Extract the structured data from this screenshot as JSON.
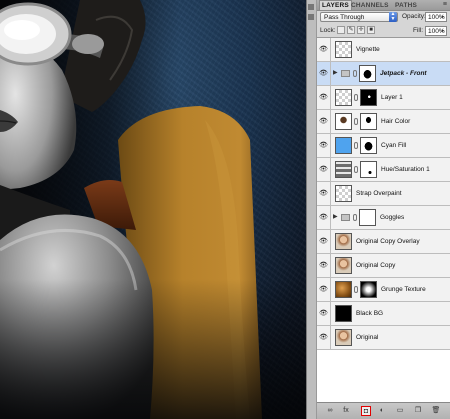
{
  "panel": {
    "tabs": [
      "LAYERS",
      "CHANNELS",
      "PATHS"
    ],
    "active_tab": "LAYERS",
    "menu_icon": "panel-menu-icon",
    "blend_mode": "Pass Through",
    "opacity_label": "Opacity:",
    "opacity_value": "100%",
    "lock_label": "Lock:",
    "fill_label": "Fill:",
    "fill_value": "100%",
    "layers": [
      {
        "name": "Vignette",
        "type": "pixel",
        "thumb": "checker",
        "mask": false,
        "group": false,
        "selected": false
      },
      {
        "name": "Jetpack - Front",
        "type": "group",
        "thumb": "folder",
        "mask": "figure",
        "group": true,
        "selected": true
      },
      {
        "name": "Layer 1",
        "type": "pixel",
        "thumb": "checker",
        "mask": "spot",
        "group": false,
        "selected": false
      },
      {
        "name": "Hair Color",
        "type": "adjustment",
        "thumb": "hair",
        "mask": "hair",
        "group": false,
        "selected": false
      },
      {
        "name": "Cyan Fill",
        "type": "fill",
        "thumb": "cyan",
        "mask": "figure",
        "group": false,
        "selected": false
      },
      {
        "name": "Hue/Saturation 1",
        "type": "adjustment",
        "thumb": "huesat",
        "mask": "spot-white",
        "group": false,
        "selected": false
      },
      {
        "name": "Strap Overpaint",
        "type": "pixel",
        "thumb": "checker",
        "mask": false,
        "group": false,
        "selected": false
      },
      {
        "name": "Goggles",
        "type": "group",
        "thumb": "folder",
        "mask": "white",
        "group": true,
        "selected": false
      },
      {
        "name": "Original Copy Overlay",
        "type": "pixel",
        "thumb": "portrait",
        "mask": false,
        "group": false,
        "selected": false
      },
      {
        "name": "Original Copy",
        "type": "pixel",
        "thumb": "portrait",
        "mask": false,
        "group": false,
        "selected": false
      },
      {
        "name": "Grunge Texture",
        "type": "pixel",
        "thumb": "grunge",
        "mask": "radial",
        "group": false,
        "selected": false
      },
      {
        "name": "Black BG",
        "type": "pixel",
        "thumb": "black",
        "mask": false,
        "group": false,
        "selected": false
      },
      {
        "name": "Original",
        "type": "pixel",
        "thumb": "portrait",
        "mask": false,
        "group": false,
        "selected": false
      }
    ],
    "footer_buttons": [
      {
        "icon": "link-layers-icon",
        "glyph": "∞"
      },
      {
        "icon": "layer-style-icon",
        "glyph": "fx"
      },
      {
        "icon": "add-mask-icon",
        "glyph": "◘",
        "highlighted": true
      },
      {
        "icon": "adjustment-layer-icon",
        "glyph": "◐"
      },
      {
        "icon": "new-group-icon",
        "glyph": "▭"
      },
      {
        "icon": "new-layer-icon",
        "glyph": "❐"
      },
      {
        "icon": "trash-icon",
        "glyph": "🗑"
      }
    ]
  }
}
